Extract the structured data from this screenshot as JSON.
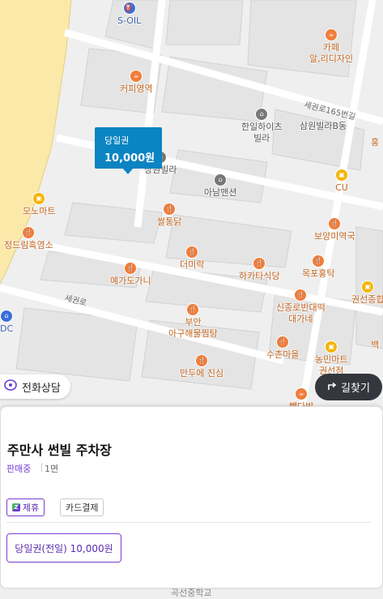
{
  "map": {
    "streets": [
      "세권로165번길",
      "세권로"
    ],
    "pois": [
      {
        "label": "S-OIL",
        "icon": "gas-station-icon",
        "style": "blue"
      },
      {
        "label": "카페\n알,리디자인",
        "icon": "cafe-icon",
        "style": "orange"
      },
      {
        "label": "커피영역",
        "icon": "cafe-icon",
        "style": "orange"
      },
      {
        "label": "한일하이츠\n빌라",
        "icon": "building-icon",
        "style": "gray"
      },
      {
        "label": "삼원빌라B동",
        "icon": "",
        "style": "gray"
      },
      {
        "label": "홍",
        "icon": "",
        "style": "orange"
      },
      {
        "label": "CU",
        "icon": "store-icon",
        "style": "orange"
      },
      {
        "label": "상원빌라",
        "icon": "building-icon",
        "style": "gray"
      },
      {
        "label": "아남맨션",
        "icon": "building-icon",
        "style": "gray"
      },
      {
        "label": "모노마트",
        "icon": "store-icon",
        "style": "orange"
      },
      {
        "label": "쌀통닭",
        "icon": "restaurant-icon",
        "style": "orange"
      },
      {
        "label": "보양미역국",
        "icon": "restaurant-icon",
        "style": "orange"
      },
      {
        "label": "정드림흑염소",
        "icon": "restaurant-icon",
        "style": "orange"
      },
      {
        "label": "더미락",
        "icon": "restaurant-icon",
        "style": "orange"
      },
      {
        "label": "하카타식당",
        "icon": "restaurant-icon",
        "style": "orange"
      },
      {
        "label": "목포홍탁",
        "icon": "restaurant-icon",
        "style": "orange"
      },
      {
        "label": "예가도가니",
        "icon": "restaurant-icon",
        "style": "orange"
      },
      {
        "label": "권선종합",
        "icon": "store-icon",
        "style": "orange"
      },
      {
        "label": "신종로반대떡\n대가네",
        "icon": "restaurant-icon",
        "style": "orange"
      },
      {
        "label": "부안\n아구해물찜탕",
        "icon": "restaurant-icon",
        "style": "orange"
      },
      {
        "label": "DC",
        "icon": "",
        "style": "blue"
      },
      {
        "label": "수촌마을",
        "icon": "restaurant-icon",
        "style": "orange"
      },
      {
        "label": "농민마트\n권선점",
        "icon": "store-icon",
        "style": "orange"
      },
      {
        "label": "백",
        "icon": "",
        "style": "orange"
      },
      {
        "label": "만두에 진심",
        "icon": "restaurant-icon",
        "style": "orange"
      },
      {
        "label": "빽다방",
        "icon": "cafe-icon",
        "style": "orange"
      }
    ],
    "bottom_label": "곡선중학교"
  },
  "price_marker": {
    "type": "당일권",
    "price": "10,000원"
  },
  "phone_button": {
    "label": "전화상담",
    "icon": "phone-icon"
  },
  "directions_button": {
    "label": "길찾기",
    "icon": "turn-right-icon"
  },
  "detail": {
    "title": "주만사 썬빌 주차장",
    "status": "판매중",
    "floor": "1면",
    "tags": [
      "제휴",
      "카드결제"
    ],
    "ticket": "당일권(전일) 10,000원"
  }
}
